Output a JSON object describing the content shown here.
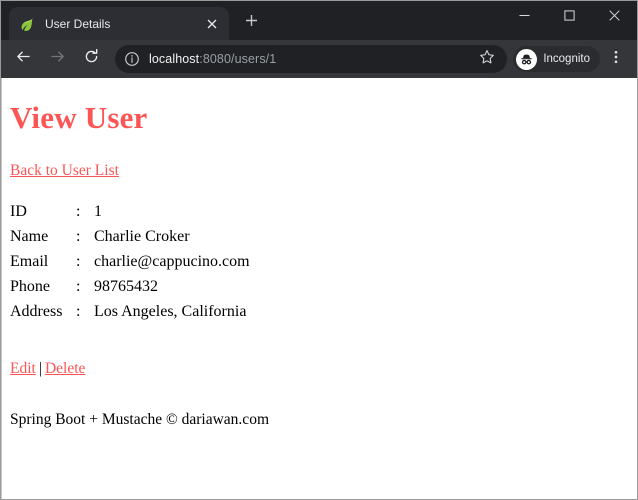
{
  "browser": {
    "tab": {
      "title": "User Details",
      "favicon_icon": "spring-leaf-icon",
      "close_icon": "close-icon"
    },
    "new_tab_icon": "plus-icon",
    "window_controls": {
      "minimize_icon": "minimize-icon",
      "maximize_icon": "maximize-icon",
      "close_icon": "close-icon"
    },
    "toolbar": {
      "back_icon": "back-arrow-icon",
      "forward_icon": "forward-arrow-icon",
      "reload_icon": "reload-icon",
      "site_info_icon": "info-circle-icon",
      "url_host": "localhost",
      "url_path": ":8080/users/1",
      "bookmark_icon": "star-icon",
      "profile_label": "Incognito",
      "profile_icon": "incognito-hat-icon",
      "menu_icon": "three-dots-vertical-icon"
    }
  },
  "page": {
    "heading": "View User",
    "back_link": "Back to User List",
    "details": [
      {
        "label": "ID",
        "sep": ":",
        "value": "1"
      },
      {
        "label": "Name",
        "sep": ":",
        "value": "Charlie Croker"
      },
      {
        "label": "Email",
        "sep": ":",
        "value": "charlie@cappucino.com"
      },
      {
        "label": "Phone",
        "sep": ":",
        "value": "98765432"
      },
      {
        "label": "Address",
        "sep": ":",
        "value": "Los Angeles, California"
      }
    ],
    "edit_link": "Edit",
    "action_separator": "|",
    "delete_link": "Delete",
    "footer": "Spring Boot + Mustache © dariawan.com",
    "accent_color": "#fc5555"
  }
}
